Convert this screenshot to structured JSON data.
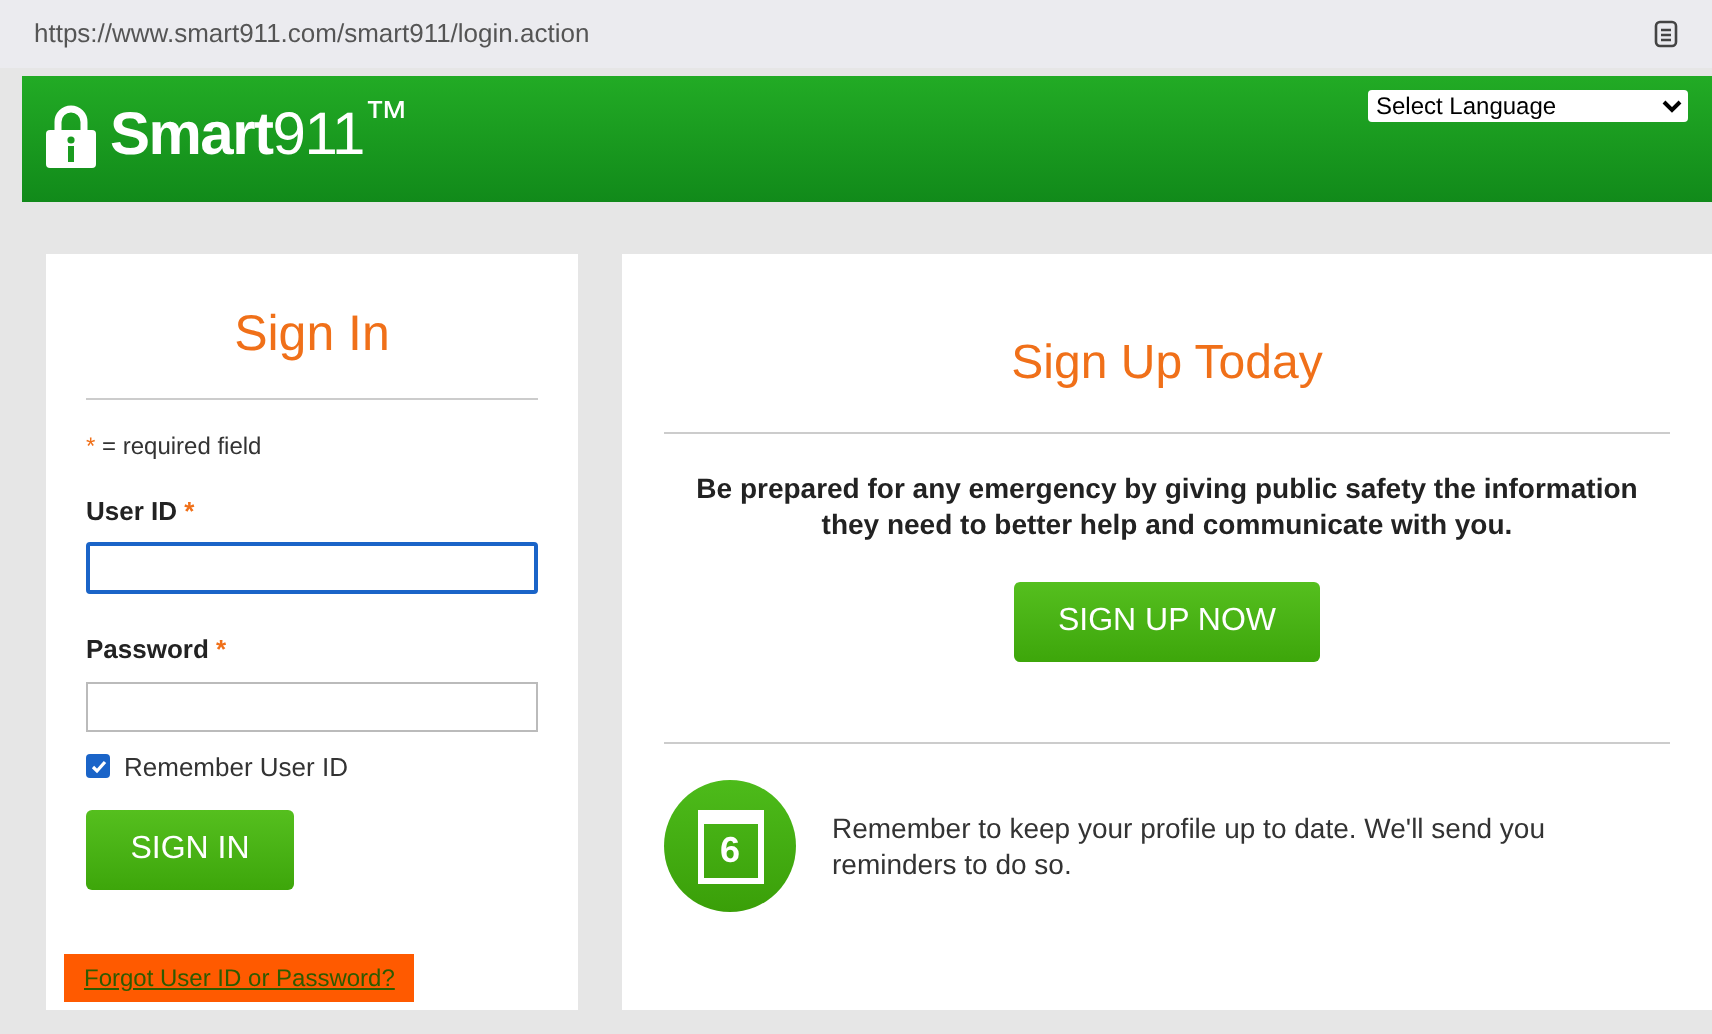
{
  "address_bar": {
    "url": "https://www.smart911.com/smart911/login.action"
  },
  "header": {
    "logo": "**Smart**911$^{™}$",
    "language_select": {
      "value": "Select Language"
    }
  },
  "sign_in": {
    "title": "Sign In",
    "required_note": {
      "mark": "*",
      "text": "= required field"
    },
    "fields": [
      {
        "label": "User ID",
        "mark": "*",
        "focused": true
      },
      {
        "label": "Password",
        "mark": "*",
        "focused": false
      }
    ],
    "remember": {
      "label": "Remember User ID",
      "checked": true
    },
    "button": "SIGN IN",
    "forgot_link": {
      "text": "Forgot User ID or Password?",
      "highlighted": true
    }
  },
  "sign_up": {
    "title": "Sign Up Today",
    "message": "Be prepared for any emergency by giving public safety the information they need to better help and communicate with you.",
    "button": "SIGN UP NOW",
    "reminder": {
      "day": "6",
      "text": "Remember to keep your profile up to date. We'll send you reminders to do so."
    }
  }
}
